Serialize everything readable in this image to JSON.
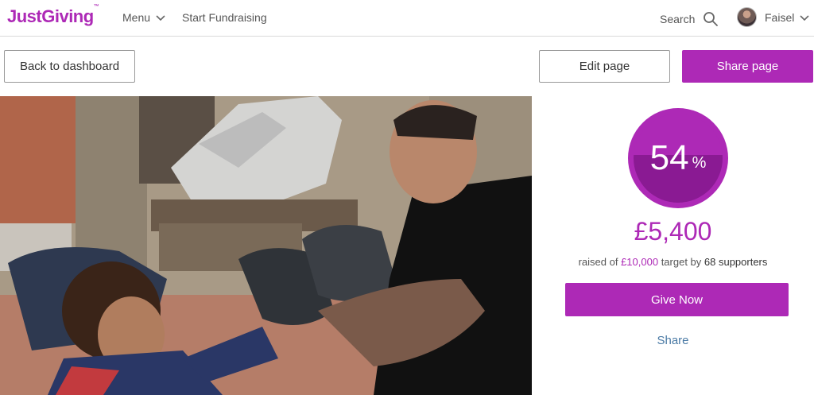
{
  "brand": {
    "logo_text": "JustGiving",
    "logo_tm": "™",
    "accent": "#ad29b6"
  },
  "nav": {
    "menu_label": "Menu",
    "start_fundraising_label": "Start Fundraising",
    "search_label": "Search",
    "user_name": "Faisel"
  },
  "toolbar": {
    "back_label": "Back to dashboard",
    "edit_label": "Edit page",
    "share_label": "Share page"
  },
  "progress": {
    "percent": 54,
    "percent_text": "54",
    "percent_symbol": "%"
  },
  "fundraising": {
    "raised": "£5,400",
    "raised_prefix": "raised of ",
    "target": "£10,000",
    "target_suffix": " target by ",
    "supporters": "68 supporters",
    "give_label": "Give Now",
    "share_label": "Share"
  }
}
